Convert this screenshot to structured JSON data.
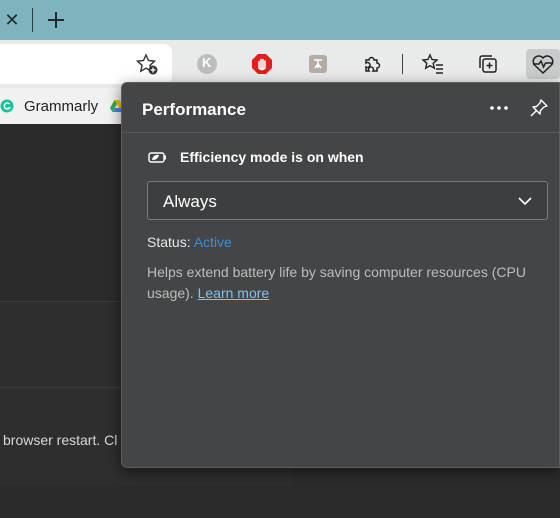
{
  "tabstrip": {
    "close_glyph": "✕",
    "new_tab_glyph": "+"
  },
  "toolbar": {
    "icons": [
      "favorite-add-icon",
      "k-extension-icon",
      "adblock-stop-icon",
      "translate-extension-icon",
      "extensions-puzzle-icon",
      "favorites-icon",
      "collections-icon",
      "performance-heartbeat-icon"
    ],
    "extension_k_letter": "K"
  },
  "favorites_bar": {
    "items": [
      {
        "label": "Grammarly",
        "icon": "grammarly-icon"
      }
    ]
  },
  "page": {
    "visible_text": "browser restart. Cl"
  },
  "popup": {
    "title": "Performance",
    "efficiency_label": "Efficiency mode is on when",
    "select_value": "Always",
    "status_label": "Status:",
    "status_value": "Active",
    "description": "Helps extend battery life by saving computer resources (CPU usage).",
    "learn_more": "Learn more"
  },
  "colors": {
    "tabstrip": "#7fb3bd",
    "popup_bg": "#444546",
    "status_active": "#3c8fd8",
    "link": "#7fc2f0",
    "adblock_red": "#e01f1f"
  }
}
